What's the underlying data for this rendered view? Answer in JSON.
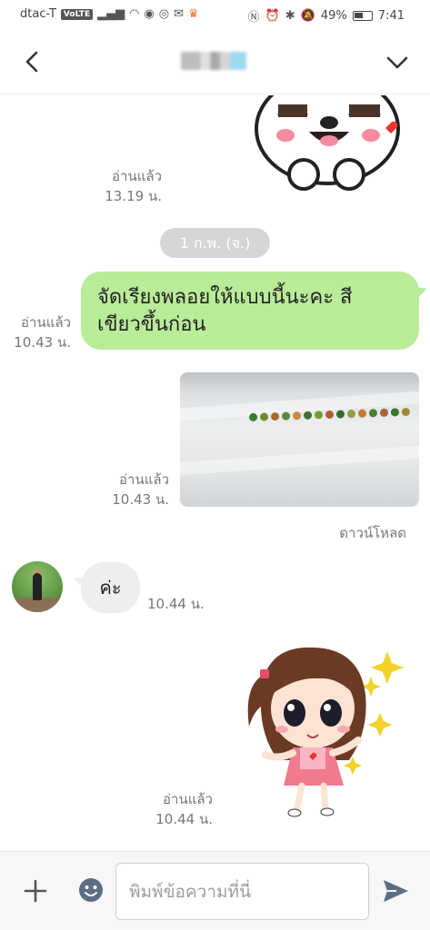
{
  "status_bar": {
    "carrier": "dtac-T",
    "volte": "VoLTE",
    "battery": "49%",
    "time": "7:41"
  },
  "header": {
    "back_icon": "chevron-left-icon",
    "menu_icon": "chevron-down-icon"
  },
  "messages": {
    "sticker1": {
      "read_label": "อ่านแล้ว",
      "time": "13.19 น."
    },
    "date_divider": "1 ก.พ. (จ.)",
    "text_out": {
      "line1": "จัดเรียงพลอยให้แบบนี้นะคะ สี",
      "line2": "เขียวขึ้นก่อน",
      "read_label": "อ่านแล้ว",
      "time": "10.43 น."
    },
    "photo": {
      "read_label": "อ่านแล้ว",
      "time": "10.43 น.",
      "download_label": "ดาวน์โหลด"
    },
    "text_in": {
      "text": "ค่ะ",
      "time": "10.44 น."
    },
    "sticker2": {
      "read_label": "อ่านแล้ว",
      "time": "10.44 น."
    }
  },
  "input_bar": {
    "placeholder": "พิมพ์ข้อความที่นี่",
    "value": ""
  },
  "colors": {
    "outgoing_bubble": "#b9ec99",
    "incoming_bubble": "#eeeeee",
    "date_pill": "#d6d6d6",
    "send_icon": "#5d6d85"
  }
}
